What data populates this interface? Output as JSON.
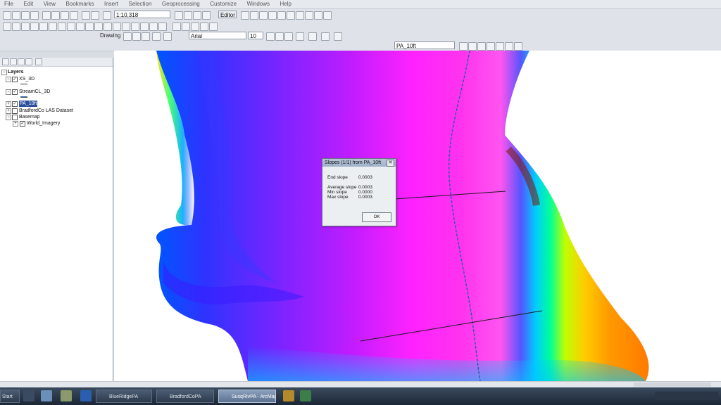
{
  "menu": [
    "File",
    "Edit",
    "View",
    "Bookmarks",
    "Insert",
    "Selection",
    "Geoprocessing",
    "Customize",
    "Windows",
    "Help"
  ],
  "toolbar": {
    "scale_value": "1:10,318",
    "editor_label": "Editor",
    "drawing_label": "Drawing",
    "font_name": "Arial",
    "font_size": "10",
    "layer_dropdown": "PA_10ft"
  },
  "toc": {
    "title": "Layers",
    "items": [
      {
        "name": "XS_3D",
        "checked": true,
        "expanded": true
      },
      {
        "name": "StreamCL_3D",
        "checked": true,
        "expanded": true
      },
      {
        "name": "PA_10ft",
        "checked": true,
        "expanded": true,
        "selected": true
      },
      {
        "name": "BradfordCo LAS Dataset",
        "checked": false,
        "expanded": false
      },
      {
        "name": "Basemap",
        "checked": false,
        "expanded": true
      },
      {
        "name": "World_Imagery",
        "checked": true,
        "expanded": false
      }
    ]
  },
  "dialog": {
    "title": "Slopes (1/1) from PA_10ft",
    "end_slope_label": "End slope",
    "end_slope_value": "0.0003",
    "average_slope_label": "Average slope",
    "average_slope_value": "0.0003",
    "min_slope_label": "Min slope",
    "min_slope_value": "0.0000",
    "max_slope_label": "Max slope",
    "max_slope_value": "0.0003",
    "ok_label": "OK"
  },
  "taskbar": {
    "start_label": "Start",
    "tasks": [
      {
        "label": "BlueRidgePA"
      },
      {
        "label": "BradfordCoPA"
      },
      {
        "label": "SusqRivPA - ArcMap",
        "active": true
      }
    ]
  },
  "colors": {
    "raster_low": "#ff00ff",
    "raster_mid": "#3a3aff",
    "raster_high": "#ffa500",
    "selection": "#2c4f9a"
  }
}
